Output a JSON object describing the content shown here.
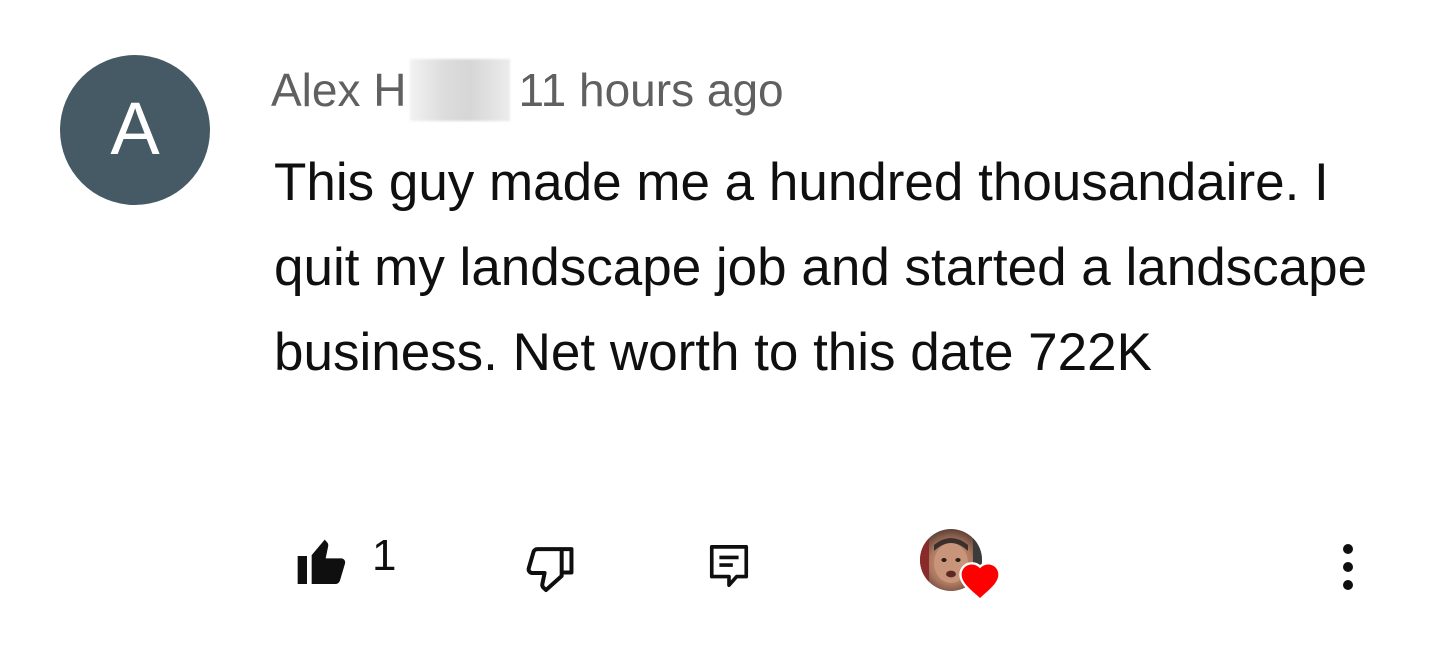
{
  "comment": {
    "avatar_letter": "A",
    "author": "Alex H",
    "timestamp": "11 hours ago",
    "text": "This guy made me a hundred thousandaire. I quit my landscape job and started a landscape business. Net worth to this date 722K",
    "like_count": "1"
  },
  "colors": {
    "avatar_bg": "#455a64",
    "heart": "#ff0000",
    "meta_text": "#606060",
    "body_text": "#0f0f0f"
  },
  "icons": {
    "like": "thumbs-up-icon",
    "dislike": "thumbs-down-icon",
    "reply": "reply-icon",
    "creator_heart": "creator-heart-icon",
    "more": "more-vertical-icon"
  }
}
